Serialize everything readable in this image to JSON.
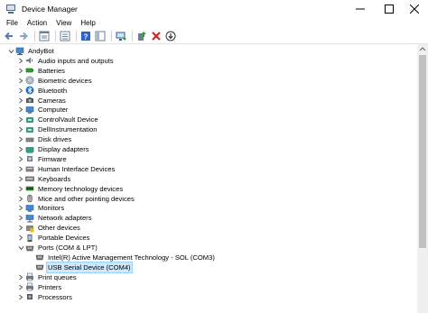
{
  "window": {
    "title": "Device Manager"
  },
  "menu": [
    "File",
    "Action",
    "View",
    "Help"
  ],
  "toolbar": [
    "back",
    "forward",
    "properties",
    "show-hidden",
    "help",
    "action-view",
    "scan-hardware",
    "enable-driver",
    "uninstall",
    "update"
  ],
  "tree": {
    "root": {
      "label": "AndyBot",
      "icon": "computer-icon",
      "expanded": true
    },
    "categories": [
      {
        "label": "Audio inputs and outputs",
        "icon": "speaker-icon",
        "expanded": false
      },
      {
        "label": "Batteries",
        "icon": "battery-icon",
        "expanded": false
      },
      {
        "label": "Biometric devices",
        "icon": "fingerprint-icon",
        "expanded": false
      },
      {
        "label": "Bluetooth",
        "icon": "bluetooth-icon",
        "expanded": false
      },
      {
        "label": "Cameras",
        "icon": "camera-icon",
        "expanded": false
      },
      {
        "label": "Computer",
        "icon": "monitor-icon",
        "expanded": false
      },
      {
        "label": "ControlVault Device",
        "icon": "device-icon",
        "expanded": false
      },
      {
        "label": "DellInstrumentation",
        "icon": "device-icon",
        "expanded": false
      },
      {
        "label": "Disk drives",
        "icon": "disk-drive-icon",
        "expanded": false
      },
      {
        "label": "Display adapters",
        "icon": "display-adapter-icon",
        "expanded": false
      },
      {
        "label": "Firmware",
        "icon": "firmware-icon",
        "expanded": false
      },
      {
        "label": "Human Interface Devices",
        "icon": "hid-icon",
        "expanded": false
      },
      {
        "label": "Keyboards",
        "icon": "keyboard-icon",
        "expanded": false
      },
      {
        "label": "Memory technology devices",
        "icon": "memory-icon",
        "expanded": false
      },
      {
        "label": "Mice and other pointing devices",
        "icon": "mouse-icon",
        "expanded": false
      },
      {
        "label": "Monitors",
        "icon": "monitor-icon",
        "expanded": false
      },
      {
        "label": "Network adapters",
        "icon": "network-icon",
        "expanded": false
      },
      {
        "label": "Other devices",
        "icon": "unknown-device-icon",
        "expanded": false
      },
      {
        "label": "Portable Devices",
        "icon": "portable-device-icon",
        "expanded": false
      },
      {
        "label": "Ports (COM & LPT)",
        "icon": "port-icon",
        "expanded": true,
        "children": [
          {
            "label": "Intel(R) Active Management Technology - SOL (COM3)",
            "icon": "port-icon",
            "selected": false
          },
          {
            "label": "USB Serial Device (COM4)",
            "icon": "port-icon",
            "selected": true
          }
        ]
      },
      {
        "label": "Print queues",
        "icon": "printer-icon",
        "expanded": false
      },
      {
        "label": "Printers",
        "icon": "printer-icon",
        "expanded": false
      },
      {
        "label": "Processors",
        "icon": "processor-icon",
        "expanded": false
      }
    ]
  },
  "colors": {
    "selection": "#cce8ff",
    "selection_border": "#99d1ff",
    "accent": "#1e6fc9"
  }
}
